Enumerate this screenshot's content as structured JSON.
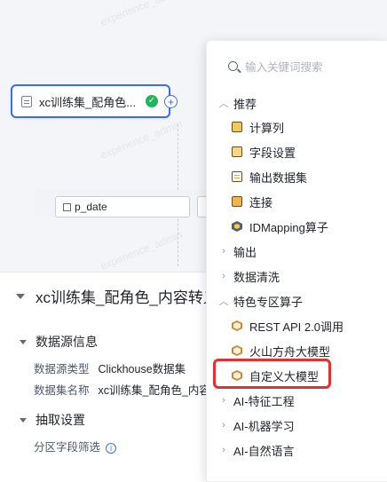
{
  "canvas": {
    "watermark": "experience_admin",
    "node": {
      "label": "xc训练集_配角色..."
    }
  },
  "panel": {
    "title": "xc训练集_配角色_内容转义_",
    "section1": "数据源信息",
    "source_type_label": "数据源类型",
    "source_type_value": "Clickhouse数据集",
    "dataset_name_label": "数据集名称",
    "dataset_name_value": "xc训练集_配角色_内容转",
    "section2": "抽取设置",
    "partition_label": "分区字段筛选",
    "partition_field_value": "p_date"
  },
  "menu": {
    "search_placeholder": "输入关键词搜索",
    "categories": {
      "recommend": "推荐",
      "output": "输出",
      "cleaning": "数据清洗",
      "special": "特色专区算子",
      "feature": "AI-特征工程",
      "ml": "AI-机器学习",
      "nlp": "AI-自然语言"
    },
    "recommend_items": [
      "计算列",
      "字段设置",
      "输出数据集",
      "连接",
      "IDMapping算子"
    ],
    "special_items": [
      "REST API 2.0调用",
      "火山方舟大模型",
      "自定义大模型"
    ]
  },
  "colors": {
    "accent": "#3a6cf4",
    "success": "#22b35e",
    "highlight": "#e5302f"
  },
  "icons": {
    "search": "search-icon",
    "check": "check-circle-icon",
    "add": "plus-circle-icon",
    "expand": "chevron-icon"
  }
}
